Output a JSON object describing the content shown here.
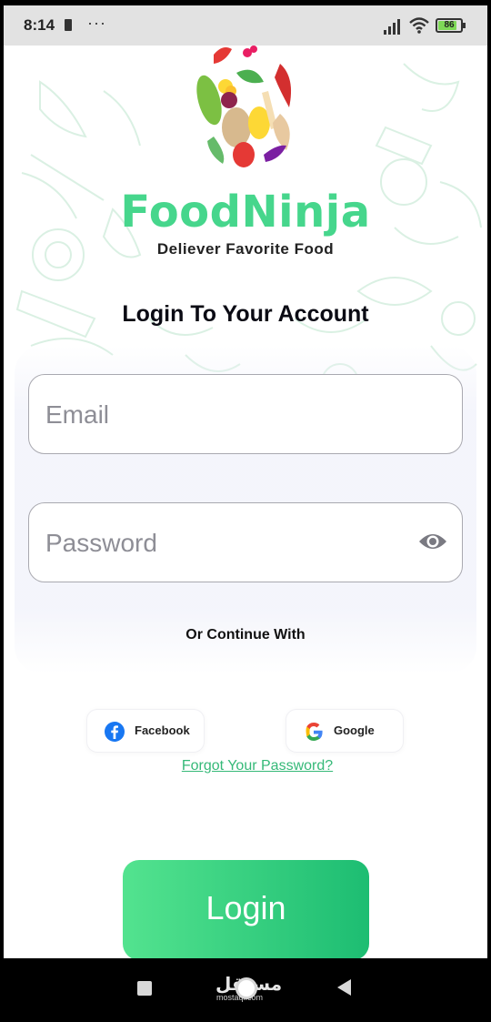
{
  "status_bar": {
    "time": "8:14",
    "dots": "···",
    "battery_level": "86",
    "battery_percent": 86
  },
  "brand": {
    "name": "FoodNinja",
    "tagline": "Deliever Favorite Food"
  },
  "heading": "Login To Your Account",
  "form": {
    "email_placeholder": "Email",
    "password_placeholder": "Password"
  },
  "or_continue": "Or Continue With",
  "social": {
    "facebook_label": "Facebook",
    "google_label": "Google"
  },
  "forgot_password": "Forgot Your Password?",
  "login_label": "Login",
  "watermark": {
    "text": "مستقل",
    "sub": "mostaql.com"
  },
  "colors": {
    "brand_green": "#46d68c",
    "button_start": "#53e38f",
    "button_end": "#1dbd72",
    "link_green": "#35b978"
  }
}
